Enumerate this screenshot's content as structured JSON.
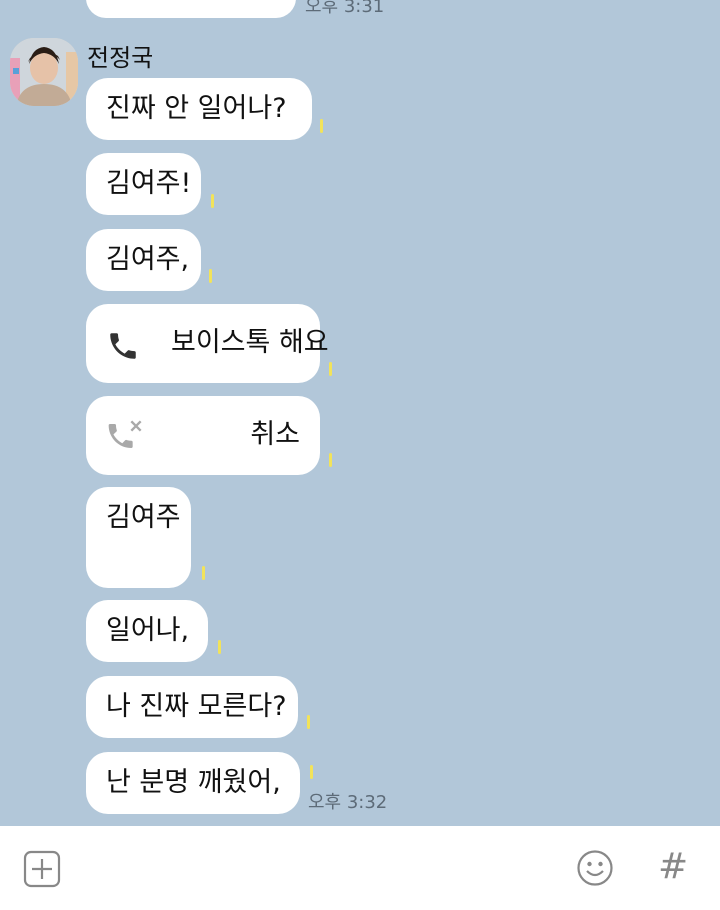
{
  "chat": {
    "prev_timestamp": "오후 3:31",
    "sender_name": "전정국",
    "messages": [
      {
        "text": "진짜 안 일어나?"
      },
      {
        "text": "김여주!"
      },
      {
        "text": "김여주,"
      },
      {
        "type": "call",
        "text": "보이스톡 해요",
        "icon": "phone-icon"
      },
      {
        "type": "call-cancelled",
        "text": "취소",
        "icon": "phone-missed-icon"
      },
      {
        "text": "김여주"
      },
      {
        "text": "일어나,"
      },
      {
        "text": "나 진짜 모른다?"
      },
      {
        "text": "난 분명 깨웠어,"
      }
    ],
    "last_timestamp": "오후 3:32",
    "unread_marker": "1"
  },
  "input_bar": {
    "left_icon": "plus-box-icon",
    "emoji_icon": "smiley-icon",
    "hash_label": "#"
  },
  "colors": {
    "background": "#b2c7d9",
    "bubble": "#ffffff",
    "unread": "#f2e35a"
  }
}
